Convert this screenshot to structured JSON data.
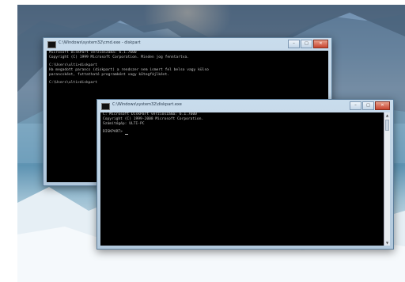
{
  "window_back": {
    "title": "C:\\Windows\\system32\\cmd.exe - diskpart",
    "lines": [
      "Microsoft DiskPart verziószáma: 6.1.7600",
      "Copyright (C) 1999 Microsoft Corporation. Minden jog fenntartva.",
      "",
      "C:\\Users\\ulti>diskpart",
      "Ha megadott parancs (diskpart) a rendszer nem ismert fel belso vagy külso",
      "parancsként, futtatható programként vagy kötegfájlként.",
      "",
      "C:\\Users\\ulti>diskpart"
    ],
    "controls": {
      "minimize": "–",
      "maximize": "□",
      "close": "✕"
    }
  },
  "window_front": {
    "title": "C:\\Windows\\system32\\diskpart.exe",
    "lines": [
      "C: Microsoft DiskPart verziószáma: 6.1.7600",
      "Copyright (C) 1999-2008 Microsoft Corporation.",
      "Számítógép: ULTI-PC",
      "",
      "DISKPART> "
    ],
    "controls": {
      "minimize": "–",
      "maximize": "□",
      "close": "✕"
    },
    "scrollbar": {
      "up": "▲",
      "down": "▼"
    }
  },
  "colors": {
    "console_bg": "#000000",
    "console_text": "#c0c0c0",
    "close_button": "#c8452f"
  },
  "icons": [
    "cmd-icon",
    "minimize-icon",
    "maximize-icon",
    "close-icon"
  ]
}
